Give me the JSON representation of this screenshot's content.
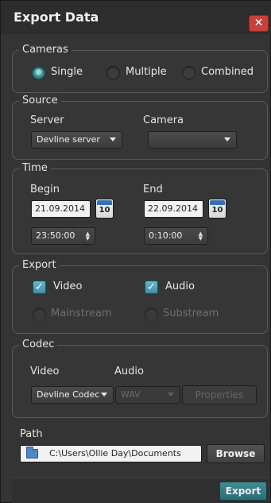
{
  "window": {
    "title": "Export Data",
    "close_glyph": "✕"
  },
  "cameras": {
    "legend": "Cameras",
    "options": [
      "Single",
      "Multiple",
      "Combined"
    ],
    "selected": "Single"
  },
  "source": {
    "legend": "Source",
    "server_label": "Server",
    "server_value": "Devline server",
    "camera_label": "Camera",
    "camera_value": ""
  },
  "time": {
    "legend": "Time",
    "begin_label": "Begin",
    "begin_date": "21.09.2014",
    "begin_time": "23:50:00",
    "end_label": "End",
    "end_date": "22.09.2014",
    "end_time": "0:10:00",
    "calendar_day": "10"
  },
  "export": {
    "legend": "Export",
    "video_label": "Video",
    "video_checked": true,
    "audio_label": "Audio",
    "audio_checked": true,
    "mainstream_label": "Mainstream",
    "substream_label": "Substream"
  },
  "codec": {
    "legend": "Codec",
    "video_label": "Video",
    "audio_label": "Audio",
    "video_value": "Devline Codec",
    "audio_value": "WAV",
    "properties_label": "Properties"
  },
  "path": {
    "label": "Path",
    "value": "C:\\Users\\Ollie Day\\Documents",
    "browse_label": "Browse"
  },
  "footer": {
    "export_label": "Export"
  },
  "colors": {
    "accent": "#3f8b94",
    "close": "#c9403a",
    "panel": "#363636"
  }
}
